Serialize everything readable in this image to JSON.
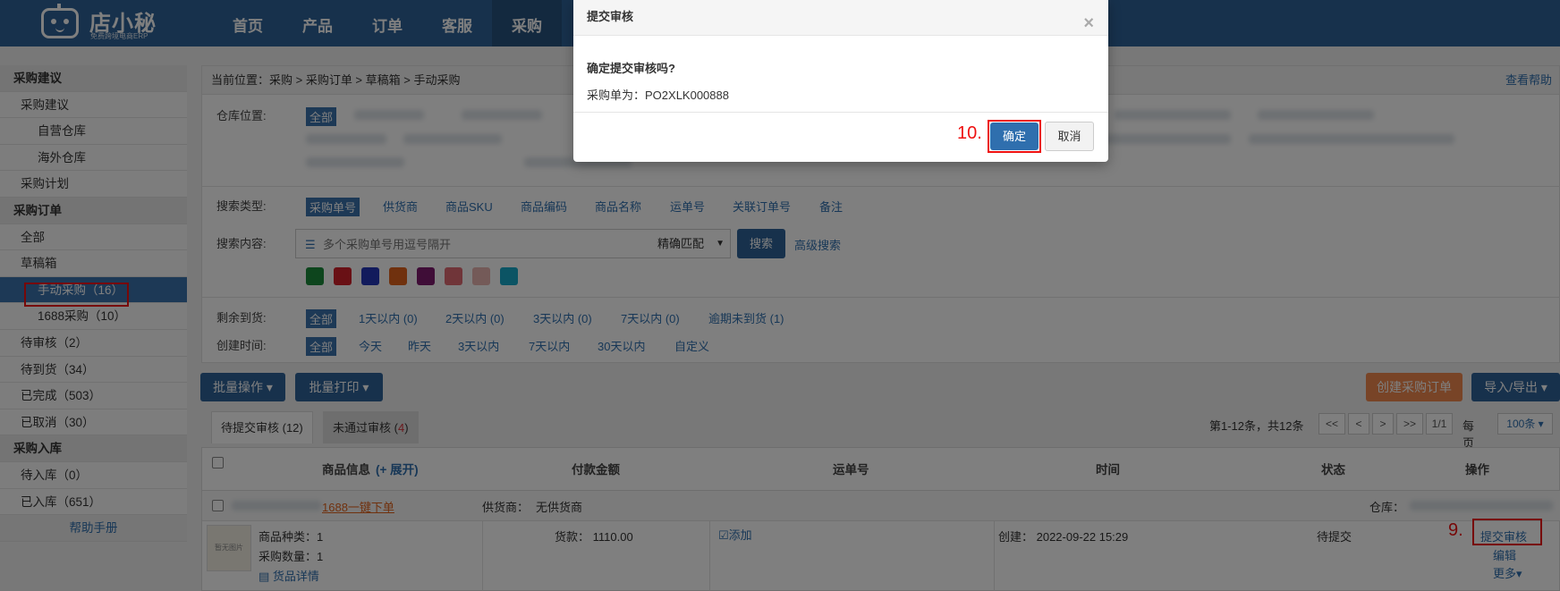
{
  "header": {
    "logo_name": "店小秘",
    "logo_sub": "免费跨境电商ERP",
    "nav": [
      "首页",
      "产品",
      "订单",
      "客服",
      "采购"
    ]
  },
  "sidebar": {
    "items": [
      {
        "label": "采购建议",
        "type": "head"
      },
      {
        "label": "采购建议",
        "type": "item"
      },
      {
        "label": "自营仓库",
        "type": "sub"
      },
      {
        "label": "海外仓库",
        "type": "sub"
      },
      {
        "label": "采购计划",
        "type": "item"
      },
      {
        "label": "采购订单",
        "type": "head"
      },
      {
        "label": "全部",
        "type": "item"
      },
      {
        "label": "草稿箱",
        "type": "item"
      },
      {
        "label": "手动采购（16）",
        "type": "sub",
        "active": true
      },
      {
        "label": "1688采购（10）",
        "type": "sub"
      },
      {
        "label": "待审核（2）",
        "type": "item"
      },
      {
        "label": "待到货（34）",
        "type": "item"
      },
      {
        "label": "已完成（503）",
        "type": "item"
      },
      {
        "label": "已取消（30）",
        "type": "item"
      },
      {
        "label": "采购入库",
        "type": "head"
      },
      {
        "label": "待入库（0）",
        "type": "item"
      },
      {
        "label": "已入库（651）",
        "type": "item"
      },
      {
        "label": "帮助手册",
        "type": "help"
      }
    ]
  },
  "breadcrumb": {
    "text": "当前位置：采购 > 采购订单 > 草稿箱 > 手动采购",
    "help": "查看帮助"
  },
  "filters": {
    "warehouse_label": "仓库位置:",
    "warehouse_all": "全部",
    "search_type_label": "搜索类型:",
    "search_types": [
      "采购单号",
      "供货商",
      "商品SKU",
      "商品编码",
      "商品名称",
      "运单号",
      "关联订单号",
      "备注"
    ],
    "search_content_label": "搜索内容:",
    "search_placeholder": "多个采购单号用逗号隔开",
    "match_mode": "精确匹配",
    "search_button": "搜索",
    "advanced_search": "高级搜索",
    "color_tags": [
      "#1a8a3a",
      "#d3212b",
      "#2436b8",
      "#e0631d",
      "#7e1a6e",
      "#e06b73",
      "#e8b4b0",
      "#17a9c9"
    ],
    "remaining_label": "剩余到货:",
    "remaining_options": [
      "全部",
      "1天以内 (0)",
      "2天以内 (0)",
      "3天以内 (0)",
      "7天以内 (0)",
      "逾期未到货 (1)"
    ],
    "created_label": "创建时间:",
    "created_options": [
      "全部",
      "今天",
      "昨天",
      "3天以内",
      "7天以内",
      "30天以内",
      "自定义"
    ]
  },
  "actions": {
    "batch_ops": "批量操作 ▾",
    "batch_print": "批量打印 ▾",
    "create_order": "创建采购订单",
    "import_export": "导入/导出 ▾"
  },
  "tabs": {
    "pending_label": "待提交审核 (12)",
    "rejected_label": "未通过审核 (",
    "rejected_count": "4",
    "rejected_close": ")"
  },
  "pager": {
    "summary": "第1-12条，共12条",
    "first": "<<",
    "prev": "<",
    "next": ">",
    "last": ">>",
    "page": "1/1",
    "per_page_label": "每页",
    "per_page": "100条 ▾"
  },
  "table": {
    "headers": {
      "product": "商品信息",
      "expand": "(+ 展开)",
      "amount": "付款金额",
      "tracking": "运单号",
      "time": "时间",
      "status": "状态",
      "ops": "操作"
    },
    "group": {
      "one_click": "1688一键下单",
      "supplier_label": "供货商：",
      "supplier": "无供货商",
      "warehouse_label": "仓库："
    },
    "row": {
      "thumb_text": "暂无图片",
      "kinds": "商品种类：1",
      "qty": "采购数量：1",
      "detail": "货品详情",
      "amount": "货款：  1110.00",
      "add": "添加",
      "created": "创建：  2022-09-22 15:29",
      "status": "待提交",
      "submit": "提交审核",
      "edit": "编辑",
      "more": "更多▾"
    }
  },
  "annotations": {
    "step9": "9.",
    "step10": "10."
  },
  "dialog": {
    "title": "提交审核",
    "close": "×",
    "question": "确定提交审核吗?",
    "order_label": "采购单为：",
    "order_no": "PO2XLK000888",
    "confirm": "确定",
    "cancel": "取消"
  }
}
